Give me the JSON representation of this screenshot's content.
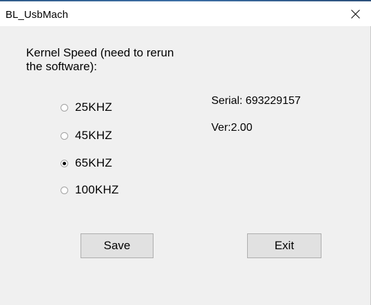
{
  "window": {
    "title": "BL_UsbMach"
  },
  "kernel": {
    "label": "Kernel Speed (need to rerun the software):",
    "options": [
      {
        "label": "25KHZ",
        "selected": false
      },
      {
        "label": "45KHZ",
        "selected": false
      },
      {
        "label": "65KHZ",
        "selected": true
      },
      {
        "label": "100KHZ",
        "selected": false
      }
    ]
  },
  "info": {
    "serial": "Serial: 693229157",
    "version": "Ver:2.00"
  },
  "buttons": {
    "save": "Save",
    "exit": "Exit"
  },
  "icons": {
    "close": "close-icon"
  },
  "colors": {
    "client_bg": "#f0f0f0",
    "titlebar_bg": "#ffffff",
    "button_bg": "#e1e1e1",
    "button_border": "#adadad"
  }
}
